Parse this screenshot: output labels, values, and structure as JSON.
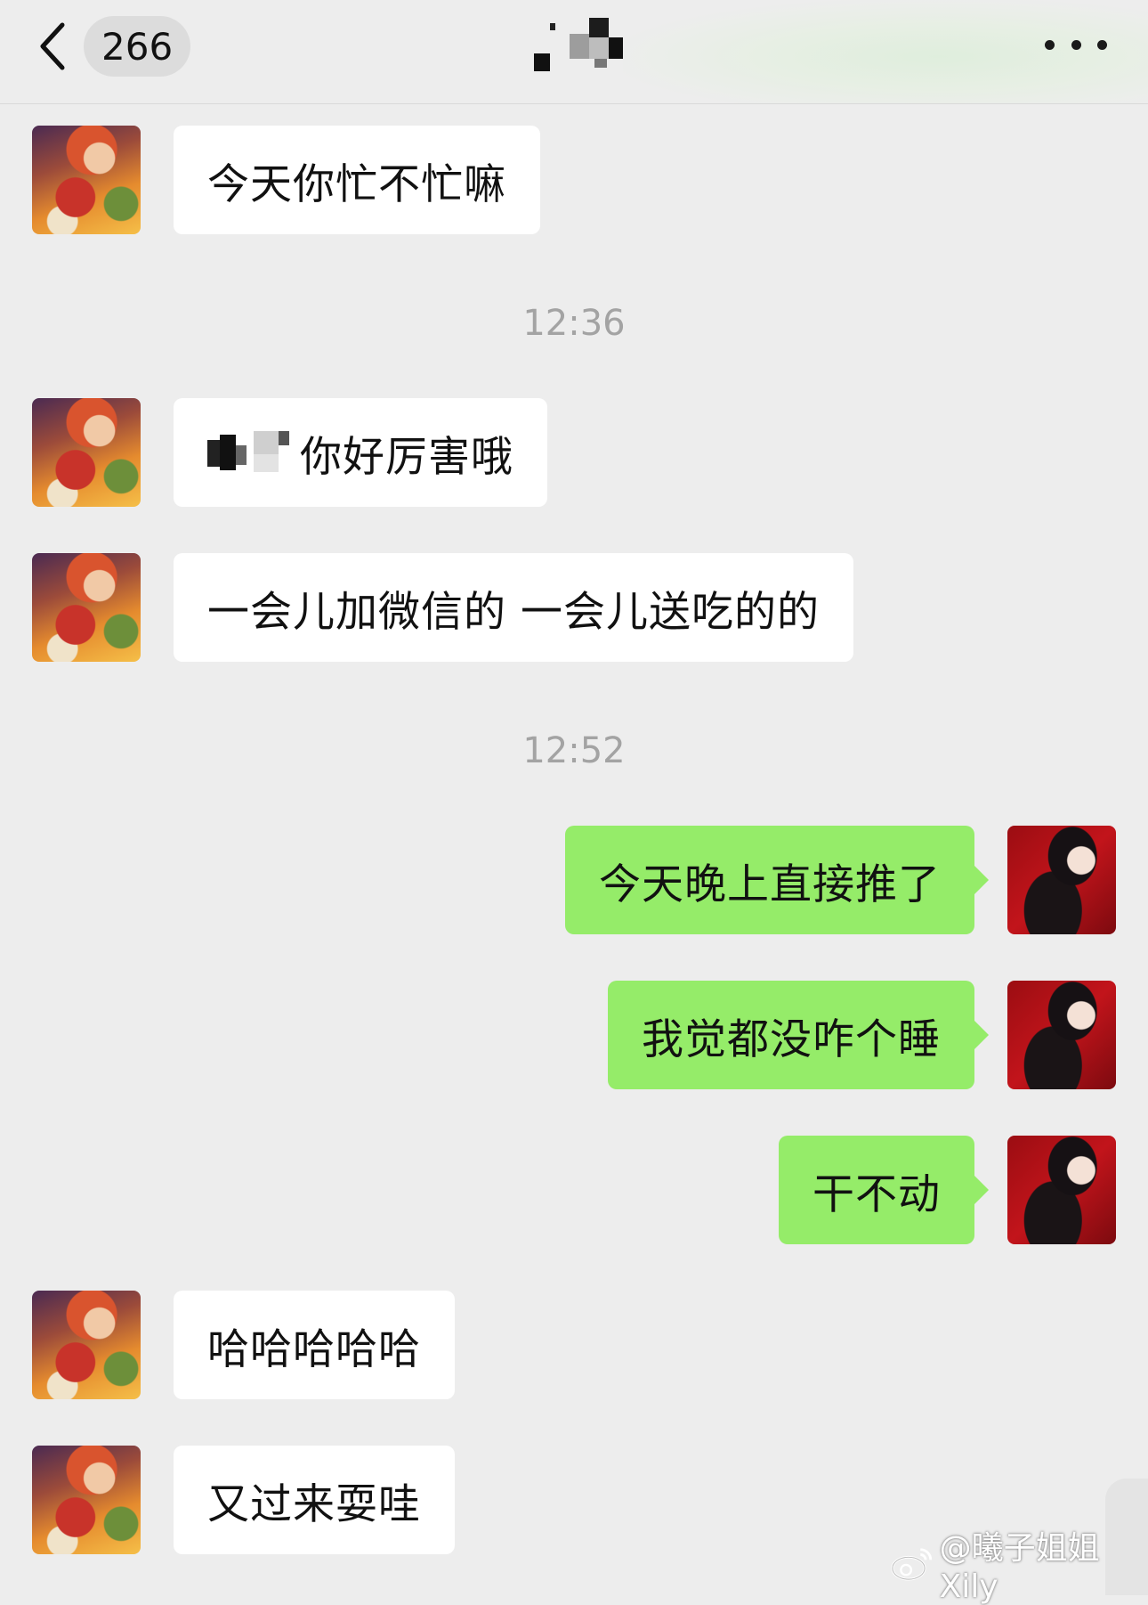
{
  "header": {
    "back_icon": "chevron-left-icon",
    "unread_count": "266",
    "more_icon": "more-dots-icon"
  },
  "messages": [
    {
      "side": "in",
      "text": "今天你忙不忙嘛"
    },
    {
      "time": "12:36"
    },
    {
      "side": "in",
      "text": "你好厉害哦",
      "redacted_prefix": true
    },
    {
      "side": "in",
      "text": "一会儿加微信的 一会儿送吃的的"
    },
    {
      "time": "12:52"
    },
    {
      "side": "out",
      "text": "今天晚上直接推了"
    },
    {
      "side": "out",
      "text": "我觉都没咋个睡"
    },
    {
      "side": "out",
      "text": "干不动"
    },
    {
      "side": "in",
      "text": "哈哈哈哈哈"
    },
    {
      "side": "in",
      "text": "又过来耍哇"
    }
  ],
  "watermark": {
    "text": "@曦子姐姐Xily",
    "icon": "weibo-logo-icon"
  },
  "colors": {
    "background": "#ededed",
    "incoming_bubble": "#ffffff",
    "outgoing_bubble": "#95ec69",
    "timestamp": "#a3a3a3"
  }
}
